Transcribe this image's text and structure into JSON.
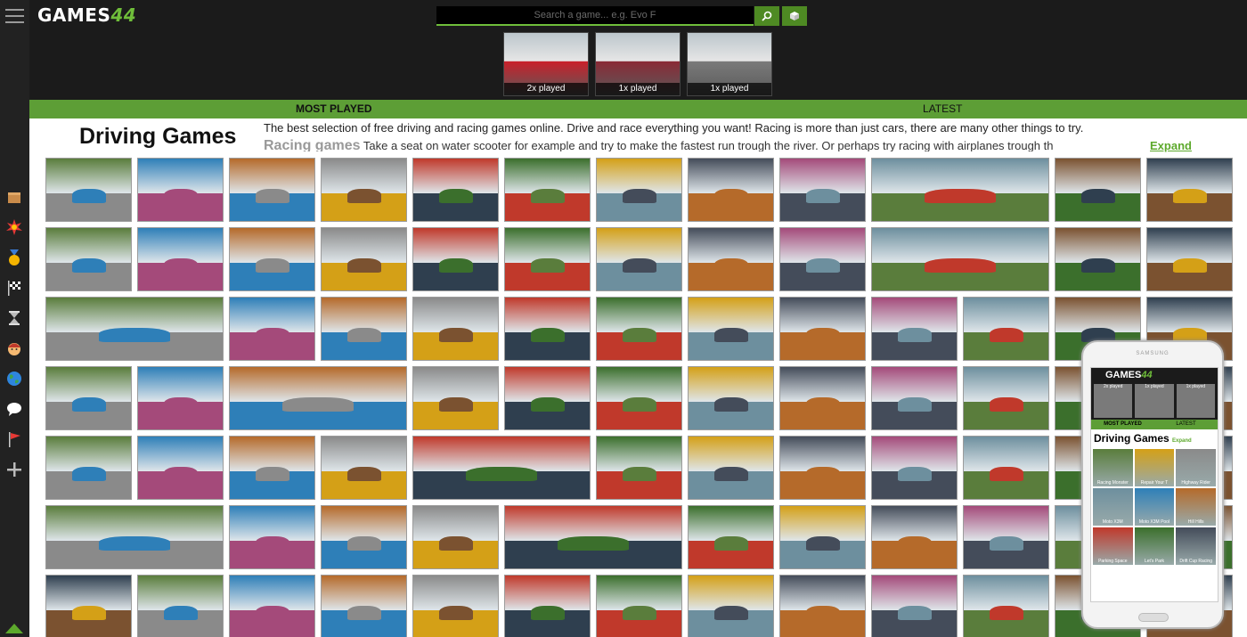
{
  "header": {
    "logo_text": "GAMES",
    "logo_num": "44",
    "search_placeholder": "Search a game... e.g. Evo F",
    "search_button_icon": "search-icon",
    "random_button_icon": "cube-icon"
  },
  "recently_played": [
    {
      "caption": "2x played",
      "color": "#c8202a"
    },
    {
      "caption": "1x played",
      "color": "#8a2a36"
    },
    {
      "caption": "1x played",
      "color": "#7a7a7a"
    }
  ],
  "tabs": [
    {
      "label": "MOST PLAYED",
      "active": true
    },
    {
      "label": "LATEST",
      "active": false
    }
  ],
  "page": {
    "title": "Driving Games",
    "description": "The best selection of free driving and racing games online. Drive and race everything you want! Racing is more than just cars, there are many other things to try.",
    "subheading": "Racing games",
    "description2": "Take a seat on water scooter for example and try to make the fastest run trough the river. Or perhaps try racing with airplanes trough th",
    "expand_label": "Expand"
  },
  "sidebar_icons": [
    "box-icon",
    "explosion-icon",
    "medal-icon",
    "checkered-flag-icon",
    "hourglass-icon",
    "face-icon",
    "globe-icon",
    "speech-bubble-icon",
    "red-flag-icon",
    "plus-icon"
  ],
  "game_palette": [
    "#5a7d3c",
    "#2e7fb8",
    "#b56a2a",
    "#8a8a8a",
    "#c0392b",
    "#3b6f2c",
    "#d4a017",
    "#444c5a",
    "#a44a7a",
    "#6d8f9e",
    "#7b5230",
    "#2f3f4f"
  ],
  "phone": {
    "brand": "SAMSUNG",
    "logo_text": "GAMES",
    "logo_num": "44",
    "recent": [
      "2x played",
      "1x played",
      "1x played"
    ],
    "tab_most": "MOST PLAYED",
    "tab_latest": "LATEST",
    "title": "Driving Games",
    "expand": "Expand",
    "games": [
      "Racing Monster",
      "Repair Your T",
      "Highway Rider",
      "Moto X3M",
      "Moto X3M Pool",
      "Hill Hills",
      "Parking Space",
      "Let's Park",
      "Drift Cup Racing"
    ]
  }
}
